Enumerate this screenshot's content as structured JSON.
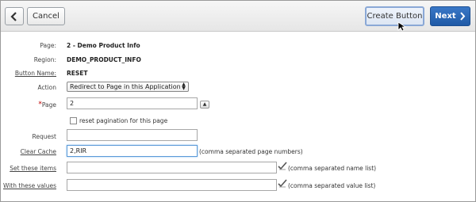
{
  "toolbar": {
    "cancel_label": "Cancel",
    "create_label": "Create Button",
    "next_label": "Next"
  },
  "form": {
    "page_label": "Page:",
    "page_value": "2 - Demo Product Info",
    "region_label": "Region:",
    "region_value": "DEMO_PRODUCT_INFO",
    "button_name_label": "Button Name:",
    "button_name_value": "RESET",
    "action_label": "Action",
    "action_value": "Redirect to Page in this Application",
    "page2_label": "Page",
    "page2_required_mark": "*",
    "page2_value": "2",
    "reset_pagination_label": "reset pagination for this page",
    "request_label": "Request",
    "request_value": "",
    "clear_cache_label": "Clear Cache",
    "clear_cache_value": "2,RIR",
    "clear_cache_hint": "(comma separated page numbers)",
    "set_items_label": "Set these items",
    "set_items_value": "",
    "set_items_hint": "(comma separated name list)",
    "with_values_label": "With these values",
    "with_values_value": "",
    "with_values_hint": "(comma separated value list)"
  },
  "icons": {
    "back": "chevron-left-icon",
    "next": "chevron-right-icon",
    "popup": "checkmark-icon"
  },
  "colors": {
    "next_button": "#2a68b8",
    "required": "#c00000",
    "focus": "#5b9ad9"
  }
}
